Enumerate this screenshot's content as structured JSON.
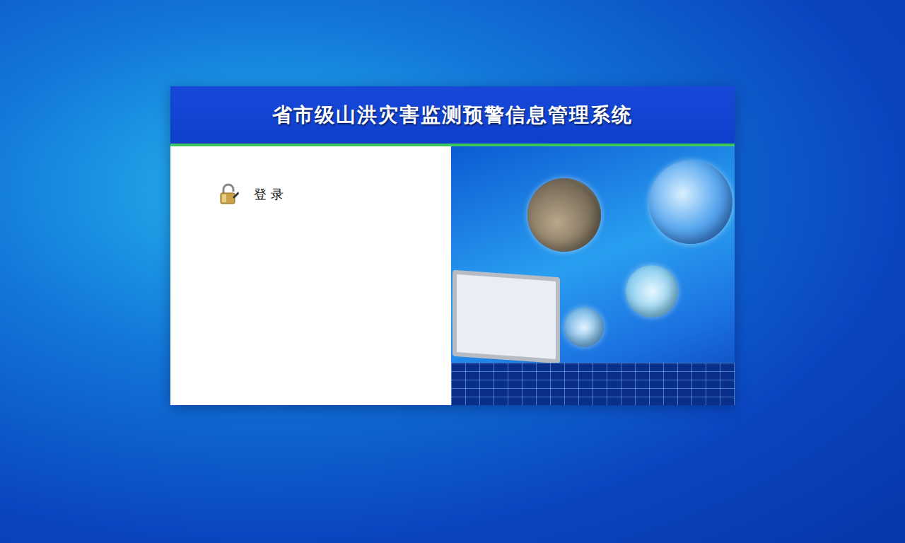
{
  "window": {
    "title": "省市级山洪灾害监测预警信息管理系统"
  },
  "login": {
    "label": "登 录"
  }
}
